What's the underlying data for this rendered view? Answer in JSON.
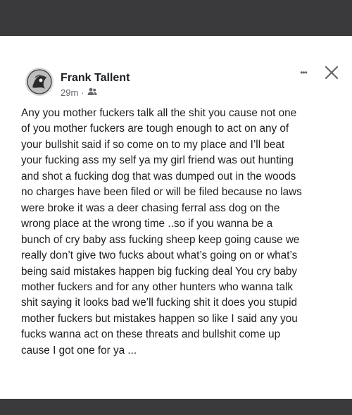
{
  "post": {
    "author": "Frank Tallent",
    "time": "29m",
    "separator": "·",
    "audience_icon": "friends-icon",
    "more_icon": "more-dots-icon",
    "more_label": "•••",
    "close_icon": "close-icon",
    "lines": [
      "Any you mother fuckers talk all the shit you cause not one",
      "of you mother fuckers are tough enough to act on any of",
      "your bullshit said if so come on to my place and I’ll beat",
      "your fucking ass my self ya my girl friend was out hunting",
      "and shot a fucking dog that was dumped out in the woods",
      "no charges have been filed or will be filed because no laws",
      "were broke it was a deer chasing ferral ass dog on the",
      "wrong place at the wrong time ..so if you wanna be a",
      "bunch of cry baby ass fucking sheep keep going cause we",
      "really don’t give two fucks about what’s going on or what’s",
      "being said mistakes happen big fucking deal You cry baby",
      "mother fuckers and for any other hunters who wanna talk",
      "shit saying it looks bad we’ll fucking shit it does you stupid",
      "mother fuckers but mistakes happen so like I said any you",
      "fucks wanna act on these threats and bullshit come up",
      "cause I got one for ya ..."
    ]
  }
}
